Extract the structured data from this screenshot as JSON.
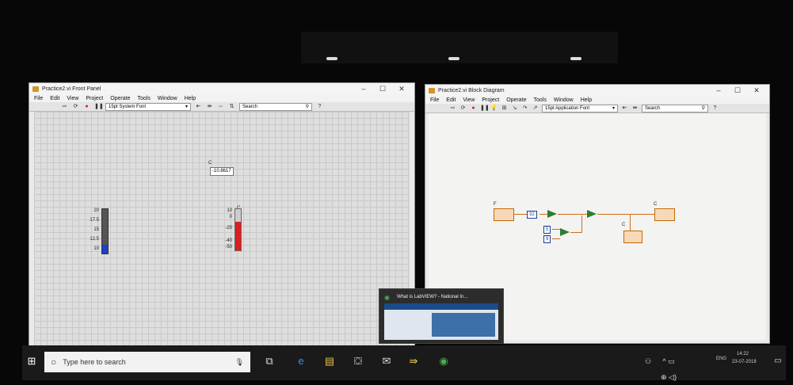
{
  "front_panel": {
    "title": "Practice2.vi Front Panel",
    "menu": [
      "File",
      "Edit",
      "View",
      "Project",
      "Operate",
      "Tools",
      "Window",
      "Help"
    ],
    "font_selector": "15pt System Font",
    "search_placeholder": "Search",
    "controls": {
      "indicator_label": "C",
      "indicator_value": "-10.8617",
      "left_scale": [
        "20",
        "17.5",
        "15",
        "12.5",
        "10"
      ],
      "right_scale": [
        "10",
        "0",
        "-20",
        "-40",
        "-50"
      ],
      "right_label": "C",
      "left_level": 0.2,
      "right_level": 0.7
    }
  },
  "block_diagram": {
    "title": "Practice2.vi Block Diagram",
    "menu": [
      "File",
      "Edit",
      "View",
      "Project",
      "Operate",
      "Tools",
      "Window",
      "Help"
    ],
    "font_selector": "15pt Application Font",
    "search_placeholder": "Search",
    "labels": {
      "input_node": "F",
      "const_32": "32",
      "const_5": "5",
      "const_9": "9",
      "output_node": "C",
      "output_node2": "C"
    }
  },
  "taskbar": {
    "search_text": "Type here to search",
    "lang": "ENG",
    "time": "14:22",
    "date": "23-07-2018",
    "popup_title": "What is LabVIEW? - National In..."
  },
  "colors": {
    "wire": "#d36c1a",
    "primitive": "#2e7d32",
    "thermo_left": "#1e3fd0",
    "thermo_right": "#d92020"
  }
}
